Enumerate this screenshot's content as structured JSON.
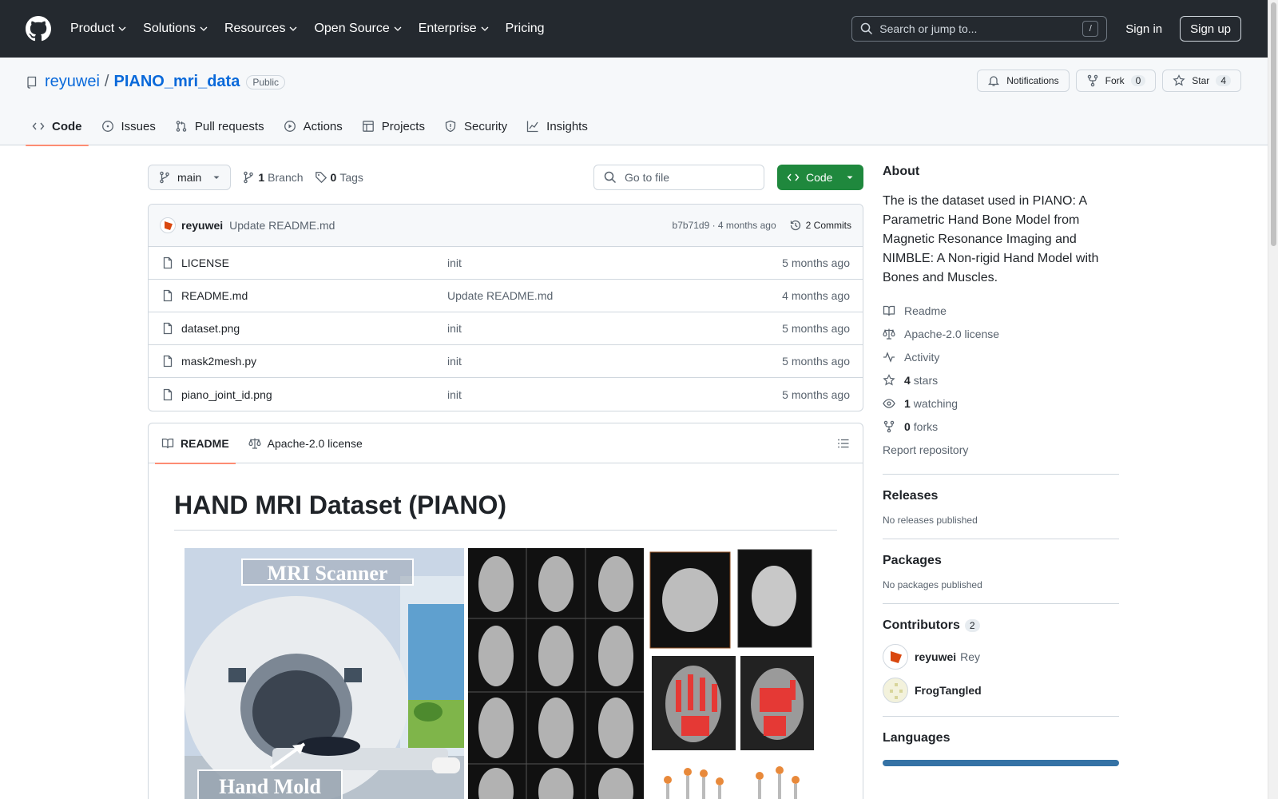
{
  "header": {
    "nav": [
      "Product",
      "Solutions",
      "Resources",
      "Open Source",
      "Enterprise",
      "Pricing"
    ],
    "search_placeholder": "Search or jump to...",
    "search_key": "/",
    "sign_in": "Sign in",
    "sign_up": "Sign up"
  },
  "repo": {
    "owner": "reyuwei",
    "separator": "/",
    "name": "PIANO_mri_data",
    "visibility": "Public",
    "notifications_label": "Notifications",
    "fork_label": "Fork",
    "fork_count": "0",
    "star_label": "Star",
    "star_count": "4",
    "tabs": [
      {
        "label": "Code",
        "icon": "code-icon"
      },
      {
        "label": "Issues",
        "icon": "issue-icon"
      },
      {
        "label": "Pull requests",
        "icon": "pull-request-icon"
      },
      {
        "label": "Actions",
        "icon": "play-icon"
      },
      {
        "label": "Projects",
        "icon": "table-icon"
      },
      {
        "label": "Security",
        "icon": "shield-icon"
      },
      {
        "label": "Insights",
        "icon": "graph-icon"
      }
    ]
  },
  "browser": {
    "branch": "main",
    "branch_count": "1",
    "branch_label": "Branch",
    "tag_count": "0",
    "tag_label": "Tags",
    "goto_placeholder": "Go to file",
    "code_button": "Code",
    "last_commit": {
      "author": "reyuwei",
      "message": "Update README.md",
      "meta": "b7b71d9 · 4 months ago",
      "commits": "2 Commits"
    },
    "files": [
      {
        "name": "LICENSE",
        "message": "init",
        "age": "5 months ago"
      },
      {
        "name": "README.md",
        "message": "Update README.md",
        "age": "4 months ago"
      },
      {
        "name": "dataset.png",
        "message": "init",
        "age": "5 months ago"
      },
      {
        "name": "mask2mesh.py",
        "message": "init",
        "age": "5 months ago"
      },
      {
        "name": "piano_joint_id.png",
        "message": "init",
        "age": "5 months ago"
      }
    ]
  },
  "readme": {
    "tab_readme": "README",
    "tab_license": "Apache-2.0 license",
    "title": "HAND MRI Dataset (PIANO)",
    "figure_label_scanner": "MRI Scanner",
    "figure_label_mold": "Hand Mold"
  },
  "about": {
    "heading": "About",
    "description": "The is the dataset used in PIANO: A Parametric Hand Bone Model from Magnetic Resonance Imaging and NIMBLE: A Non-rigid Hand Model with Bones and Muscles.",
    "readme": "Readme",
    "license": "Apache-2.0 license",
    "activity": "Activity",
    "stars_count": "4",
    "stars_label": "stars",
    "watching_count": "1",
    "watching_label": "watching",
    "forks_count": "0",
    "forks_label": "forks",
    "report": "Report repository"
  },
  "releases": {
    "heading": "Releases",
    "text": "No releases published"
  },
  "packages": {
    "heading": "Packages",
    "text": "No packages published"
  },
  "contributors": {
    "heading": "Contributors",
    "count": "2",
    "list": [
      {
        "login": "reyuwei",
        "name": "Rey"
      },
      {
        "login": "FrogTangled",
        "name": ""
      }
    ]
  },
  "languages": {
    "heading": "Languages"
  },
  "colors": {
    "header_bg": "#24292f",
    "link": "#0969da",
    "primary_button": "#1f883d",
    "tab_underline": "#fd8c73"
  }
}
